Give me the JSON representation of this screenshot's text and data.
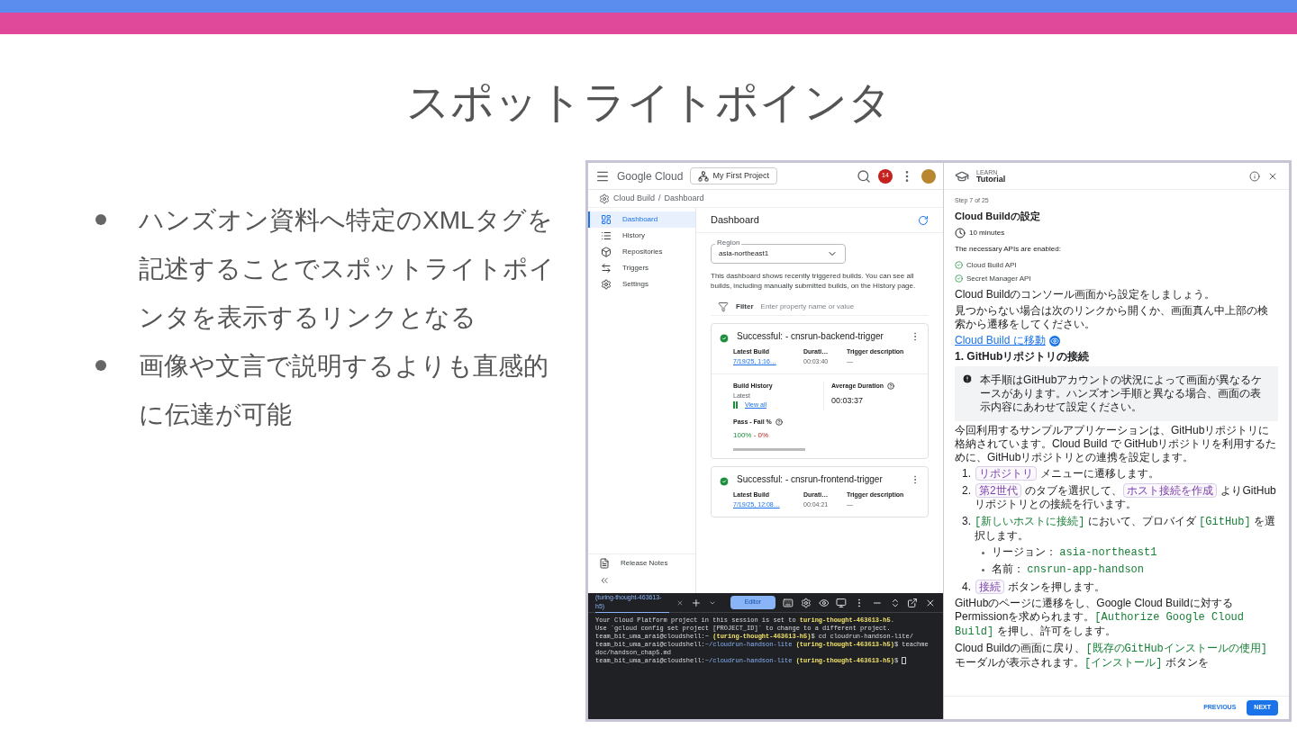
{
  "slide": {
    "title": "スポットライトポインタ",
    "bullets": [
      "ハンズオン資料へ特定のXMLタグを記述することでスポットライトポインタを表示するリンクとなる",
      "画像や文言で説明するよりも直感的に伝達が可能"
    ]
  },
  "screenshot": {
    "console": {
      "logo": "Google Cloud",
      "project": "My First Project",
      "notifications": "14",
      "breadcrumb": [
        "Cloud Build",
        "/",
        "Dashboard"
      ],
      "nav": [
        {
          "label": "Dashboard",
          "selected": true
        },
        {
          "label": "History",
          "selected": false
        },
        {
          "label": "Repositories",
          "selected": false
        },
        {
          "label": "Triggers",
          "selected": false
        },
        {
          "label": "Settings",
          "selected": false
        }
      ],
      "footer_nav": [
        {
          "label": "Release Notes"
        }
      ],
      "page_title": "Dashboard",
      "region": {
        "label": "Region",
        "value": "asia-northeast1"
      },
      "description": "This dashboard shows recently triggered builds. You can see all builds, including manually submitted builds, on the History page.",
      "filter": {
        "label": "Filter",
        "placeholder": "Enter property name or value"
      },
      "builds": [
        {
          "status": "Successful: - cnsrun-backend-trigger",
          "columns": [
            "Latest Build",
            "Durati…",
            "Trigger description"
          ],
          "latest": "7/19/25, 1:16…",
          "duration": "00:03:40",
          "trigger": "—",
          "details": {
            "history_label": "Build History",
            "latest_label": "Latest",
            "view_all": "View all",
            "avg_label": "Average Duration",
            "avg": "00:03:37",
            "passfail_label": "Pass - Fail %",
            "pass": "100%",
            "separator": " - ",
            "fail": "0%"
          }
        },
        {
          "status": "Successful: - cnsrun-frontend-trigger",
          "columns": [
            "Latest Build",
            "Durati…",
            "Trigger description"
          ],
          "latest": "7/19/25, 12:08…",
          "duration": "00:04:21",
          "trigger": "—"
        }
      ]
    },
    "terminal": {
      "tab": "(turing-thought-463613-h5)",
      "editor": "Editor",
      "lines": [
        [
          {
            "kind": "plain",
            "text": "Your Cloud Platform project in this session is set to "
          },
          {
            "kind": "project",
            "text": "turing-thought-463613-h5"
          },
          {
            "kind": "plain",
            "text": "."
          }
        ],
        [
          {
            "kind": "plain",
            "text": "Use `gcloud config set project [PROJECT_ID]` to change to a different project."
          }
        ],
        [
          {
            "kind": "plain",
            "text": "team_bit_uma_arai@cloudshell:~ "
          },
          {
            "kind": "project",
            "text": "(turing-thought-463613-h5)"
          },
          {
            "kind": "plain",
            "text": "$ cd cloudrun-handson-lite/"
          }
        ],
        [
          {
            "kind": "plain",
            "text": "team_bit_uma_arai@cloudshell:"
          },
          {
            "kind": "path",
            "text": "~/cloudrun-handson-lite "
          },
          {
            "kind": "project",
            "text": "(turing-thought-463613-h5)"
          },
          {
            "kind": "plain",
            "text": "$ teachme doc/handson_chap5.md"
          }
        ],
        [
          {
            "kind": "plain",
            "text": "team_bit_uma_arai@cloudshell:"
          },
          {
            "kind": "path",
            "text": "~/cloudrun-handson-lite "
          },
          {
            "kind": "project",
            "text": "(turing-thought-463613-h5)"
          },
          {
            "kind": "plain",
            "text": "$"
          },
          {
            "kind": "cursor"
          }
        ]
      ]
    },
    "tutorial": {
      "eyebrow": "LEARN",
      "title": "Tutorial",
      "step": "Step 7 of 25",
      "heading": "Cloud Buildの設定",
      "duration": "10 minutes",
      "apis_intro": "The necessary APIs are enabled:",
      "apis": [
        "Cloud Build API",
        "Secret Manager API"
      ],
      "body": [
        {
          "kind": "paragraph",
          "parts": [
            {
              "kind": "text",
              "text": "Cloud Buildのコンソール画面から設定をしましょう。"
            }
          ]
        },
        {
          "kind": "paragraph",
          "parts": [
            {
              "kind": "text",
              "text": "見つからない場合は次のリンクから開くか、画面真ん中上部の検索から遷移をしてください。"
            }
          ]
        },
        {
          "kind": "link",
          "text": "Cloud Build に移動"
        },
        {
          "kind": "heading",
          "text": "1. GitHubリポジトリの接続"
        },
        {
          "kind": "note",
          "text": "本手順はGitHubアカウントの状況によって画面が異なるケースがあります。ハンズオン手順と異なる場合、画面の表示内容にあわせて設定ください。"
        },
        {
          "kind": "paragraph",
          "parts": [
            {
              "kind": "text",
              "text": "今回利用するサンプルアプリケーションは、GitHubリポジトリに格納されています。Cloud Build で GitHubリポジトリを利用するために、GitHubリポジトリとの連携を設定します。"
            }
          ]
        },
        {
          "kind": "steps",
          "items": [
            {
              "number": "1.",
              "parts": [
                {
                  "kind": "chip",
                  "text": "リポジトリ"
                },
                {
                  "kind": "text",
                  "text": " メニューに遷移します。"
                }
              ]
            },
            {
              "number": "2.",
              "parts": [
                {
                  "kind": "chip",
                  "text": "第2世代"
                },
                {
                  "kind": "text",
                  "text": " のタブを選択して、"
                },
                {
                  "kind": "chip",
                  "text": "ホスト接続を作成"
                },
                {
                  "kind": "text",
                  "text": " よりGitHubリポジトリとの接続を行います。"
                }
              ]
            },
            {
              "number": "3.",
              "parts": [
                {
                  "kind": "code",
                  "text": "[新しいホストに接続]"
                },
                {
                  "kind": "text",
                  "text": " において、プロバイダ "
                },
                {
                  "kind": "code",
                  "text": "[GitHub]"
                },
                {
                  "kind": "text",
                  "text": " を選択します。"
                }
              ],
              "sub": [
                [
                  {
                    "kind": "text",
                    "text": "リージョン： "
                  },
                  {
                    "kind": "code",
                    "text": "asia-northeast1"
                  }
                ],
                [
                  {
                    "kind": "text",
                    "text": "名前： "
                  },
                  {
                    "kind": "code",
                    "text": "cnsrun-app-handson"
                  }
                ]
              ]
            },
            {
              "number": "4.",
              "parts": [
                {
                  "kind": "chip",
                  "text": "接続"
                },
                {
                  "kind": "text",
                  "text": " ボタンを押します。"
                }
              ]
            }
          ]
        },
        {
          "kind": "paragraph",
          "parts": [
            {
              "kind": "text",
              "text": "GitHubのページに遷移をし、Google Cloud Buildに対するPermissionを求められます。"
            },
            {
              "kind": "code",
              "text": "[Authorize Google Cloud Build]"
            },
            {
              "kind": "text",
              "text": " を押し、許可をします。"
            }
          ]
        },
        {
          "kind": "paragraph",
          "parts": [
            {
              "kind": "text",
              "text": "Cloud Buildの画面に戻り、"
            },
            {
              "kind": "code",
              "text": "[既存のGitHubインストールの使用]"
            },
            {
              "kind": "text",
              "text": " モーダルが表示されます。"
            },
            {
              "kind": "code",
              "text": "[インストール]"
            },
            {
              "kind": "text",
              "text": " ボタンを"
            }
          ]
        }
      ],
      "previous": "PREVIOUS",
      "next": "NEXT"
    }
  }
}
